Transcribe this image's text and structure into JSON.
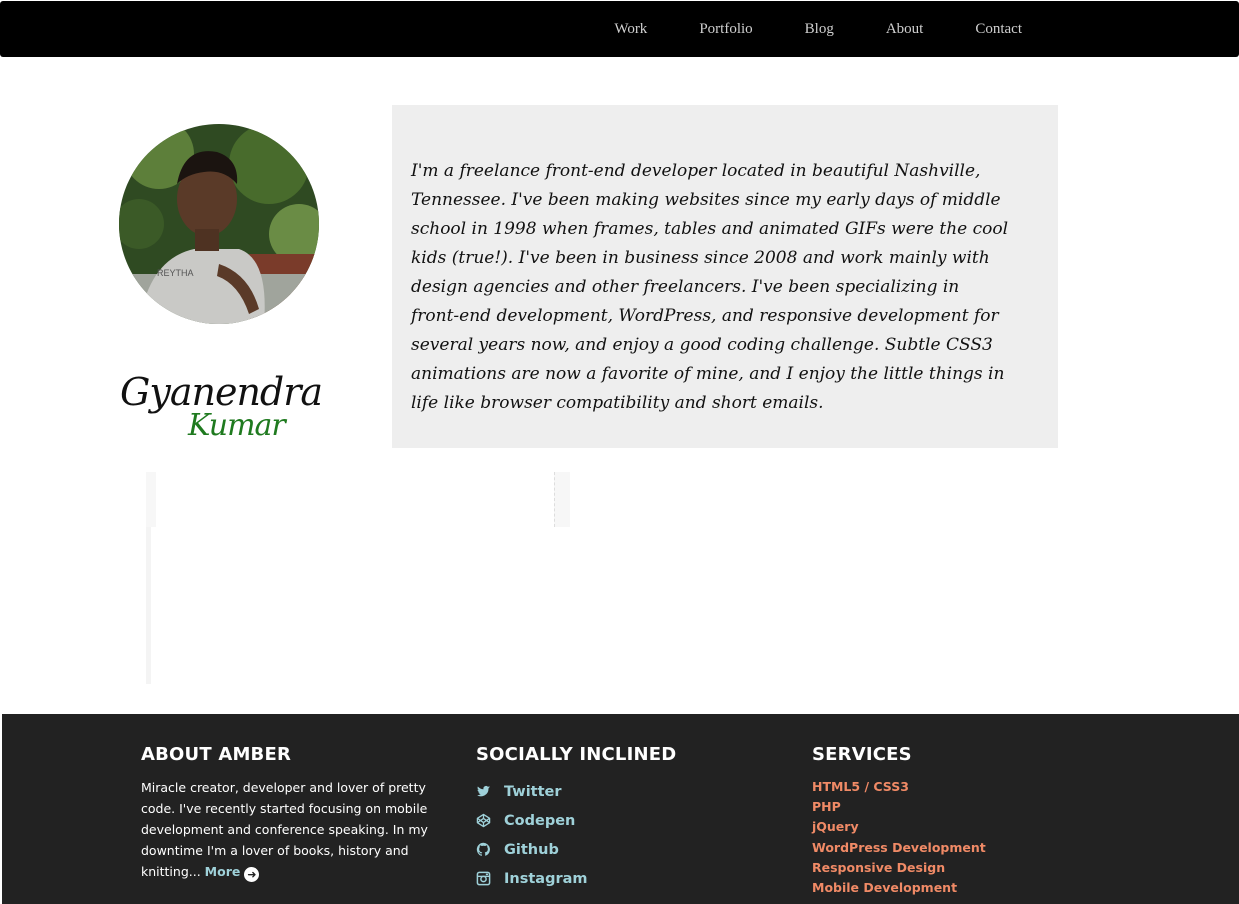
{
  "nav": {
    "items": [
      "Work",
      "Portfolio",
      "Blog",
      "About",
      "Contact"
    ]
  },
  "profile": {
    "first_name": "Gyanendra",
    "last_name": "Kumar",
    "bio": "I'm a freelance front-end developer located in beautiful Nashville, Tennessee. I've been making websites since my early days of middle school in 1998 when frames, tables and animated GIFs were the cool kids (true!). I've been in business since 2008 and work mainly with design agencies and other freelancers. I've been specializing in front-end development, WordPress, and responsive development for several years now, and enjoy a good coding challenge. Subtle CSS3 animations are now a favorite of mine, and I enjoy the little things in life like browser compatibility and short emails."
  },
  "footer": {
    "about": {
      "heading": "ABOUT AMBER",
      "text": "Miracle creator, developer and lover of pretty code. I've recently started focusing on mobile development and conference speaking. In my downtime I'm a lover of books, history and knitting...",
      "more_label": "More"
    },
    "social": {
      "heading": "SOCIALLY INCLINED",
      "items": [
        {
          "label": "Twitter",
          "icon": "twitter-icon"
        },
        {
          "label": "Codepen",
          "icon": "codepen-icon"
        },
        {
          "label": "Github",
          "icon": "github-icon"
        },
        {
          "label": "Instagram",
          "icon": "instagram-icon"
        }
      ]
    },
    "services": {
      "heading": "SERVICES",
      "items": [
        "HTML5 / CSS3",
        "PHP",
        "jQuery",
        "WordPress Development",
        "Responsive Design",
        "Mobile Development"
      ]
    }
  },
  "colors": {
    "nav_bg": "#000000",
    "footer_bg": "#222222",
    "link_teal": "#9fd1d9",
    "service_orange": "#f08a66",
    "signature_green": "#1f7a1f",
    "bio_bg": "#eeeeee"
  }
}
